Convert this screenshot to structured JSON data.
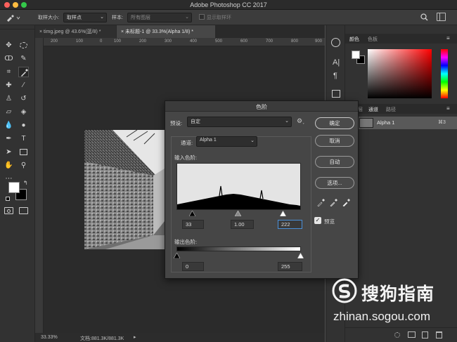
{
  "app": {
    "title": "Adobe Photoshop CC 2017"
  },
  "options_bar": {
    "sample_size_label": "取样大小:",
    "sample_size_value": "取样点",
    "sample_label": "样本:",
    "sample_value": "所有图层",
    "show_ring_label": "显示取样环"
  },
  "tabs": [
    {
      "label": "timg.jpeg @ 43.6%(蓝/8) *"
    },
    {
      "label": "未标题-1 @ 33.3%(Alpha 1/8) *"
    }
  ],
  "ruler": {
    "ticks": [
      "200",
      "100",
      "0",
      "100",
      "200",
      "300",
      "400",
      "500",
      "600",
      "700",
      "800",
      "900"
    ]
  },
  "status": {
    "zoom": "33.33%",
    "doc": "文档:881.3K/881.3K"
  },
  "right_panel": {
    "color_tabs": [
      "颜色",
      "色板"
    ],
    "channels_tabs": [
      "层",
      "通道",
      "路径"
    ],
    "channel_name": "Alpha 1",
    "channel_shortcut": "⌘3"
  },
  "levels_dialog": {
    "title": "色阶",
    "preset_label": "预设:",
    "preset_value": "自定",
    "channel_label": "通道:",
    "channel_value": "Alpha 1",
    "input_levels_label": "输入色阶:",
    "output_levels_label": "输出色阶:",
    "input_black": "33",
    "input_gamma": "1.00",
    "input_white": "222",
    "output_black": "0",
    "output_white": "255",
    "buttons": {
      "ok": "确定",
      "cancel": "取消",
      "auto": "自动",
      "options": "选项..."
    },
    "preview_label": "预览",
    "preview_checked": true
  },
  "watermark": {
    "brand": "搜狗指南",
    "url": "zhinan.sogou.com"
  },
  "colors": {
    "accent": "#4a90d9",
    "panel": "#323232",
    "dialog": "#464646"
  }
}
